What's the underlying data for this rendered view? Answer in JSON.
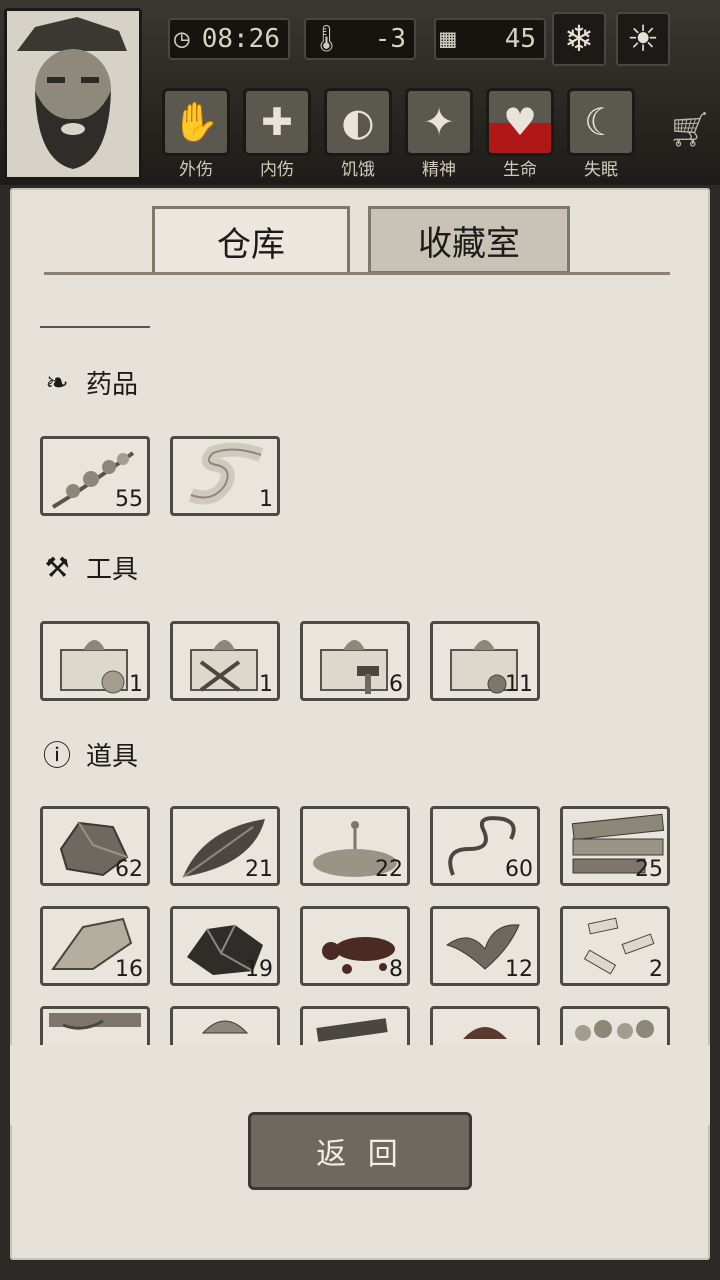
{
  "hud": {
    "time": "08:26",
    "temperature": "-3",
    "days": "45",
    "status_labels": [
      "外伤",
      "内伤",
      "饥饿",
      "精神",
      "生命",
      "失眠"
    ],
    "life_level": 0.45
  },
  "tabs": {
    "warehouse": "仓库",
    "collection": "收藏室"
  },
  "sections": {
    "medicine": {
      "title": "药品",
      "items": [
        {
          "icon": "herb-branch-icon",
          "count": "55"
        },
        {
          "icon": "bandage-icon",
          "count": "1"
        }
      ]
    },
    "tools": {
      "title": "工具",
      "items": [
        {
          "icon": "gift-box-food-icon",
          "count": "1"
        },
        {
          "icon": "gift-box-weapons-icon",
          "count": "1"
        },
        {
          "icon": "gift-box-hammer-icon",
          "count": "6"
        },
        {
          "icon": "gift-box-wood-icon",
          "count": "11"
        }
      ]
    },
    "props": {
      "title": "道具",
      "items": [
        {
          "icon": "stone-icon",
          "count": "62"
        },
        {
          "icon": "leaf-icon",
          "count": "21"
        },
        {
          "icon": "water-puddle-icon",
          "count": "22"
        },
        {
          "icon": "vine-icon",
          "count": "60"
        },
        {
          "icon": "planks-icon",
          "count": "25"
        },
        {
          "icon": "flint-icon",
          "count": "16"
        },
        {
          "icon": "coal-icon",
          "count": "19"
        },
        {
          "icon": "blood-icon",
          "count": "8"
        },
        {
          "icon": "mint-leaves-icon",
          "count": "12"
        },
        {
          "icon": "cloth-strips-icon",
          "count": "2"
        },
        {
          "icon": "rope-icon",
          "count": ""
        },
        {
          "icon": "shell-icon",
          "count": ""
        },
        {
          "icon": "metal-icon",
          "count": ""
        },
        {
          "icon": "meat-icon",
          "count": ""
        },
        {
          "icon": "gravel-icon",
          "count": ""
        }
      ]
    }
  },
  "back_button": "返 回"
}
